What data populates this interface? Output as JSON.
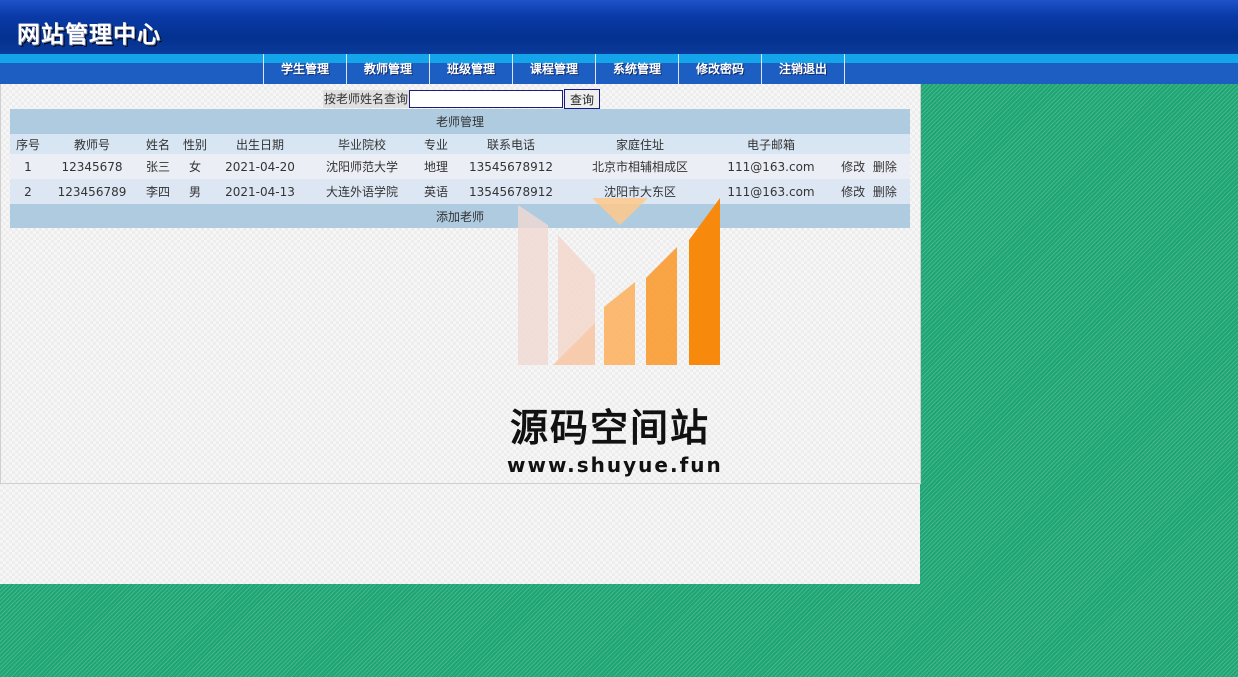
{
  "header": {
    "title": "网站管理中心"
  },
  "nav": [
    {
      "label": "学生管理"
    },
    {
      "label": "教师管理"
    },
    {
      "label": "班级管理"
    },
    {
      "label": "课程管理"
    },
    {
      "label": "系统管理"
    },
    {
      "label": "修改密码"
    },
    {
      "label": "注销退出"
    }
  ],
  "search": {
    "label": "按老师姓名查询",
    "value": "",
    "button": "查询"
  },
  "table": {
    "title": "老师管理",
    "columns": [
      "序号",
      "教师号",
      "姓名",
      "性别",
      "出生日期",
      "毕业院校",
      "专业",
      "联系电话",
      "家庭住址",
      "电子邮箱",
      ""
    ],
    "rows": [
      {
        "no": "1",
        "id": "12345678",
        "name": "张三",
        "gender": "女",
        "birth": "2021-04-20",
        "school": "沈阳师范大学",
        "major": "地理",
        "phone": "13545678912",
        "address": "北京市相辅相成区",
        "email": "111@163.com",
        "edit": "修改",
        "delete": "删除"
      },
      {
        "no": "2",
        "id": "123456789",
        "name": "李四",
        "gender": "男",
        "birth": "2021-04-13",
        "school": "大连外语学院",
        "major": "英语",
        "phone": "13545678912",
        "address": "沈阳市大东区",
        "email": "111@163.com",
        "edit": "修改",
        "delete": "删除"
      }
    ],
    "add_label": "添加老师"
  },
  "watermark": {
    "title": "源码空间站",
    "url": "www.shuyue.fun"
  },
  "colors": {
    "header": "#03318f",
    "nav": "#1d5ec2",
    "accent": "#14a4ea",
    "table_title": "#aecbe0",
    "background": "#1ea574"
  }
}
